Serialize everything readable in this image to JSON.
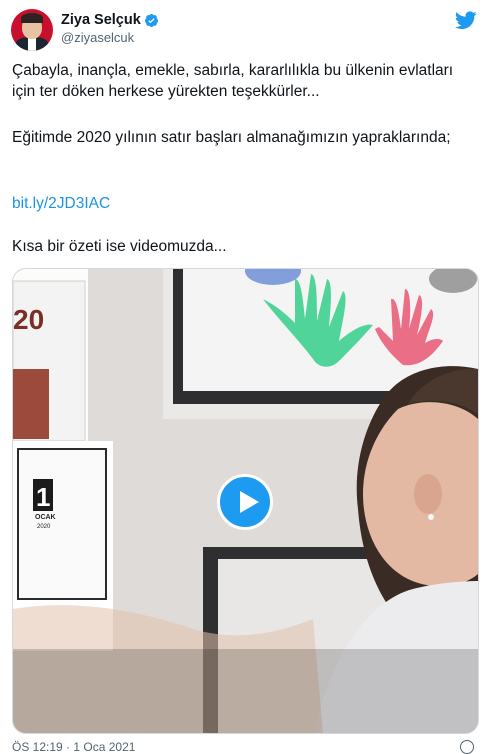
{
  "author": {
    "name": "Ziya Selçuk",
    "handle": "@ziyaselcuk",
    "verified_icon": "verified-badge-icon",
    "avatar": "avatar"
  },
  "brand": {
    "icon": "twitter-bird-icon",
    "color": "#1d9bf0"
  },
  "tweet": {
    "paragraph_1": "Çabayla, inançla, emekle, sabırla, kararlılıkla bu ülkenin evlatları için ter döken herkese yürekten teşekkürler...",
    "paragraph_2": "Eğitimde 2020 yılının satır başları almanağımızın yapraklarında;",
    "link": "bit.ly/2JD3IAC",
    "paragraph_4": "Kısa bir özeti ise videomuzda..."
  },
  "video": {
    "play_icon": "play-icon",
    "calendar_day": "1",
    "calendar_month": "OCAK",
    "calendar_year": "2020",
    "poster_text": "20"
  },
  "footer": {
    "timestamp": "ÖS 12:19 · 1 Oca 2021",
    "info_icon": "info-icon"
  }
}
